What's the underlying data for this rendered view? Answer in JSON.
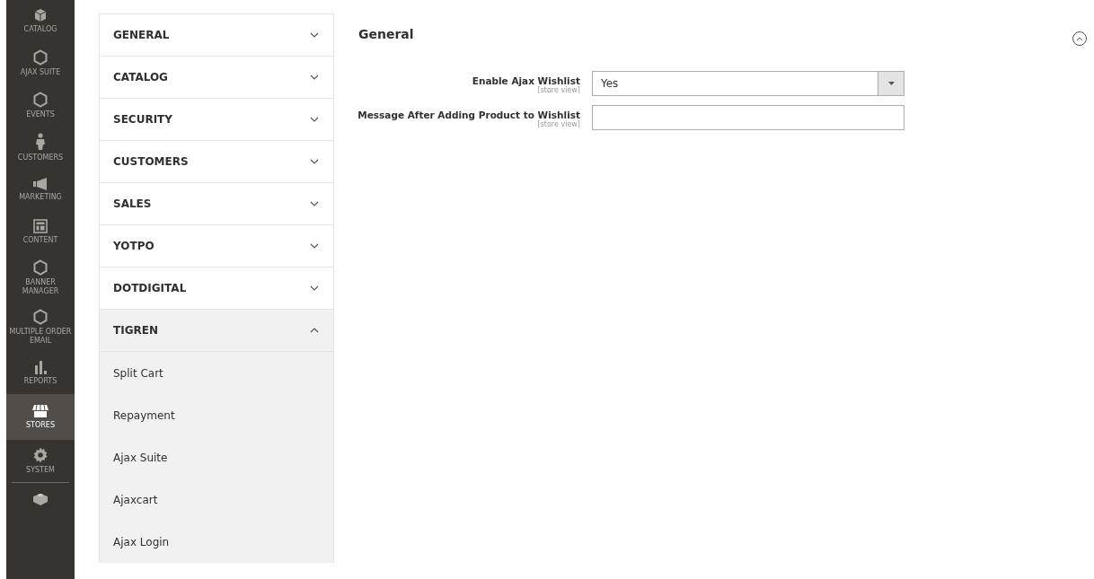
{
  "sidebar": {
    "items": [
      {
        "kind": "box",
        "label": "CATALOG",
        "selected": false
      },
      {
        "kind": "hex",
        "label": "AJAX SUITE",
        "selected": false
      },
      {
        "kind": "hex",
        "label": "EVENTS",
        "selected": false
      },
      {
        "kind": "person",
        "label": "CUSTOMERS",
        "selected": false
      },
      {
        "kind": "megaphone",
        "label": "MARKETING",
        "selected": false
      },
      {
        "kind": "layout",
        "label": "CONTENT",
        "selected": false
      },
      {
        "kind": "hex",
        "label": "BANNER MANAGER",
        "selected": false
      },
      {
        "kind": "hex",
        "label": "MULTIPLE ORDER EMAIL",
        "selected": false
      },
      {
        "kind": "bars",
        "label": "REPORTS",
        "selected": false
      },
      {
        "kind": "store",
        "label": "STORES",
        "selected": true
      },
      {
        "kind": "gear",
        "label": "SYSTEM",
        "selected": false
      },
      {
        "kind": "brick",
        "selected": false
      }
    ]
  },
  "config_menu": [
    {
      "label": "GENERAL",
      "expanded": false
    },
    {
      "label": "CATALOG",
      "expanded": false
    },
    {
      "label": "SECURITY",
      "expanded": false
    },
    {
      "label": "CUSTOMERS",
      "expanded": false
    },
    {
      "label": "SALES",
      "expanded": false
    },
    {
      "label": "YOTPO",
      "expanded": false
    },
    {
      "label": "DOTDIGITAL",
      "expanded": false
    },
    {
      "label": "TIGREN",
      "expanded": true,
      "children": [
        "Split Cart",
        "Repayment",
        "Ajax Suite",
        "Ajaxcart",
        "Ajax Login"
      ]
    }
  ],
  "section": {
    "title": "General",
    "expanded": true,
    "fields": [
      {
        "kind": "select",
        "label": "Enable Ajax Wishlist",
        "scope": "[store view]",
        "value": "Yes"
      },
      {
        "kind": "text",
        "label": "Message After Adding Product to Wishlist",
        "scope": "[store view]"
      }
    ]
  }
}
